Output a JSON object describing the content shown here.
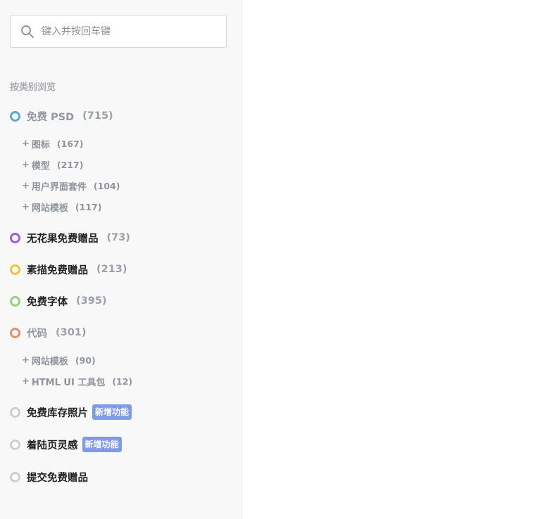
{
  "search": {
    "placeholder": "键入并按回车键",
    "value": ""
  },
  "browse_heading": "按类别浏览",
  "colors": {
    "psd": "#5aa9d6",
    "fig": "#9b5fe0",
    "sketch": "#f0c23f",
    "fonts": "#9bcf7c",
    "code": "#ea8c6e",
    "neutral": "#c9d1cf",
    "badge": "#7f9be8"
  },
  "categories": [
    {
      "label": "免费 PSD",
      "count": "(715)",
      "dot_icon": "ring-dot-icon",
      "subitems": [
        {
          "label": "图标",
          "count": "(167)"
        },
        {
          "label": "模型",
          "count": "(217)"
        },
        {
          "label": "用户界面套件",
          "count": "(104)"
        },
        {
          "label": "网站模板",
          "count": "(117)"
        }
      ]
    },
    {
      "label": "无花果免费赠品",
      "count": "(73)"
    },
    {
      "label": "素描免费赠品",
      "count": "(213)"
    },
    {
      "label": "免费字体",
      "count": "(395)"
    },
    {
      "label": "代码",
      "count": "(301)",
      "subitems": [
        {
          "label": "网站模板",
          "count": "(90)"
        },
        {
          "label": "HTML UI 工具包",
          "count": "(12)"
        }
      ]
    },
    {
      "label": "免费库存照片",
      "badge": "新增功能"
    },
    {
      "label": "着陆页灵感",
      "badge": "新增功能"
    },
    {
      "label": "提交免费赠品"
    }
  ],
  "plus": "+"
}
